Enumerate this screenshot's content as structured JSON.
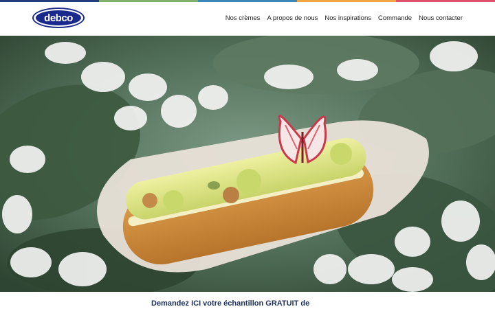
{
  "brand": {
    "logo_text": "debco"
  },
  "colors": {
    "topbar": [
      "#1f3d7a",
      "#7fb069",
      "#f2a541",
      "#3a86b4",
      "#e0506d"
    ],
    "brand_blue": "#1a2a8c",
    "cta_text": "#1d2f5c"
  },
  "nav": {
    "items": [
      {
        "label": "Nos crèmes"
      },
      {
        "label": "A propos de nous"
      },
      {
        "label": "Nos inspirations"
      },
      {
        "label": "Commande"
      },
      {
        "label": "Nous contacter"
      }
    ]
  },
  "hero": {
    "image_subject": "eclair-with-butterfly-decoration-on-leaves-and-flowers"
  },
  "cta": {
    "text": "Demandez ICI votre échantillon GRATUIT de"
  }
}
